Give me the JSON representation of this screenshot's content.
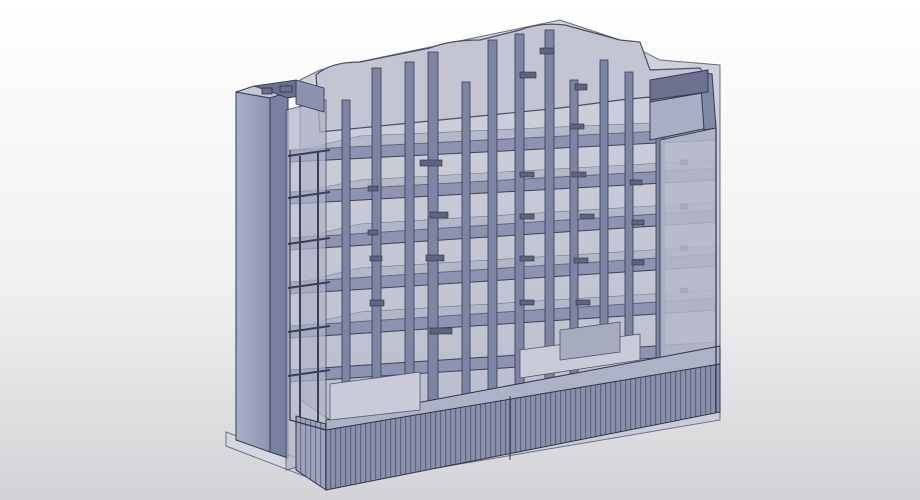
{
  "viewport": {
    "background_top": "#ffffff",
    "background_bottom": "#d2d3d6"
  },
  "model": {
    "description_icon": "building-3d-model-icon",
    "colors": {
      "wall": "#9aa0ba",
      "wall_dark": "#6d7392",
      "wall_light": "#b8bcd0",
      "slab": "#8f95b2",
      "glass": "#c8cad6",
      "edge": "#3a3d52",
      "base": "#d4d6df",
      "podium": "#7b819e",
      "podium_stripe": "#5a5f78"
    }
  }
}
